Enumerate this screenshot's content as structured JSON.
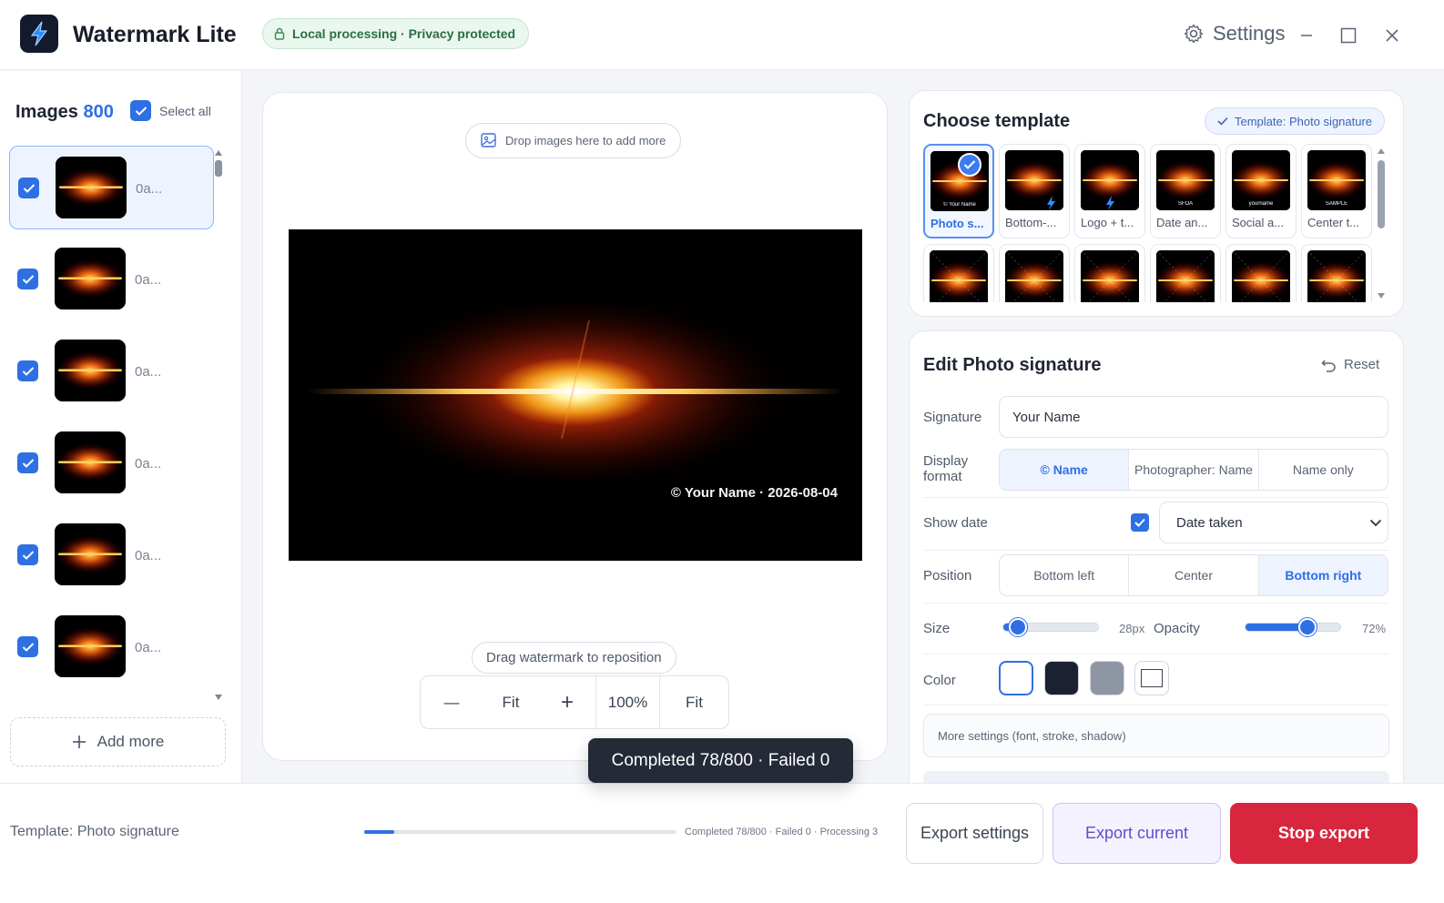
{
  "app": {
    "title": "Watermark Lite",
    "privacy": "Local processing · Privacy protected",
    "settings_label": "Settings"
  },
  "sidebar": {
    "images_label": "Images",
    "images_count": "800",
    "select_all": "Select all",
    "items": [
      {
        "name": "0a...",
        "checked": true,
        "selected": true
      },
      {
        "name": "0a...",
        "checked": true,
        "selected": false
      },
      {
        "name": "0a...",
        "checked": true,
        "selected": false
      },
      {
        "name": "0a...",
        "checked": true,
        "selected": false
      },
      {
        "name": "0a...",
        "checked": true,
        "selected": false
      },
      {
        "name": "0a...",
        "checked": true,
        "selected": false
      }
    ],
    "add_more": "Add more"
  },
  "canvas": {
    "drop_hint": "Drop images here to add more",
    "watermark_text": "© Your Name · 2026-08-04",
    "drag_hint": "Drag watermark to reposition",
    "zoom": {
      "minus": "—",
      "fit_left": "Fit",
      "plus": "+",
      "level": "100%",
      "fit_right": "Fit"
    }
  },
  "templates": {
    "title": "Choose template",
    "current_chip": "Template: Photo signature",
    "items": [
      {
        "label": "Photo s...",
        "selected": true,
        "mark": "© Your Name"
      },
      {
        "label": "Bottom-...",
        "selected": false,
        "mark": ""
      },
      {
        "label": "Logo + t...",
        "selected": false,
        "mark": ""
      },
      {
        "label": "Date an...",
        "selected": false,
        "mark": "SFOA"
      },
      {
        "label": "Social a...",
        "selected": false,
        "mark": "yourname"
      },
      {
        "label": "Center t...",
        "selected": false,
        "mark": "SAMPLE"
      },
      {
        "label": "",
        "selected": false,
        "mark": ""
      },
      {
        "label": "",
        "selected": false,
        "mark": ""
      },
      {
        "label": "",
        "selected": false,
        "mark": ""
      },
      {
        "label": "",
        "selected": false,
        "mark": ""
      },
      {
        "label": "",
        "selected": false,
        "mark": ""
      },
      {
        "label": "",
        "selected": false,
        "mark": ""
      }
    ]
  },
  "edit": {
    "title": "Edit Photo signature",
    "reset": "Reset",
    "signature_label": "Signature",
    "signature_value": "Your Name",
    "display_format_label": "Display format",
    "display_format_options": [
      "© Name",
      "Photographer: Name",
      "Name only"
    ],
    "display_format_selected": "© Name",
    "show_date_label": "Show date",
    "show_date_checked": true,
    "date_source": "Date taken",
    "position_label": "Position",
    "position_options": [
      "Bottom left",
      "Center",
      "Bottom right"
    ],
    "position_selected": "Bottom right",
    "size_label": "Size",
    "size_value": "28px",
    "size_fraction": 0.15,
    "opacity_label": "Opacity",
    "opacity_value": "72%",
    "opacity_fraction": 0.65,
    "color_label": "Color",
    "colors": [
      "#ffffff",
      "#1b2130",
      "#8e96a3",
      "#ffffff"
    ],
    "selected_color_index": 0,
    "more_settings": "More settings (font, stroke, shadow)"
  },
  "toast": "Completed 78/800 · Failed 0",
  "footer": {
    "template_label": "Template: Photo signature",
    "progress_fraction": 0.0975,
    "progress_text": "Completed 78/800 · Failed 0 · Processing 3",
    "export_settings": "Export settings",
    "export_current": "Export current",
    "stop_export": "Stop export"
  },
  "colors": {
    "accent": "#2f6fe4",
    "danger": "#d7263d",
    "success": "#2c6e44"
  }
}
